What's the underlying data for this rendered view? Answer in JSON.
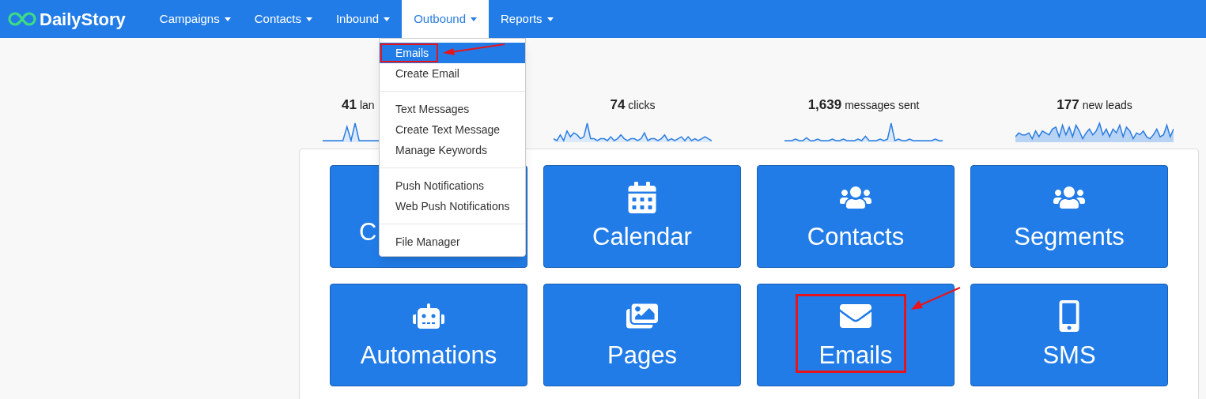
{
  "brand": {
    "name": "DailyStory"
  },
  "nav": [
    {
      "label": "Campaigns",
      "selected": false
    },
    {
      "label": "Contacts",
      "selected": false
    },
    {
      "label": "Inbound",
      "selected": false
    },
    {
      "label": "Outbound",
      "selected": true
    },
    {
      "label": "Reports",
      "selected": false
    }
  ],
  "dropdown": {
    "groups": [
      [
        {
          "label": "Emails",
          "selected": true,
          "callout": true
        },
        {
          "label": "Create Email",
          "selected": false,
          "callout": false
        }
      ],
      [
        {
          "label": "Text Messages",
          "selected": false,
          "callout": false
        },
        {
          "label": "Create Text Message",
          "selected": false,
          "callout": false
        },
        {
          "label": "Manage Keywords",
          "selected": false,
          "callout": false
        }
      ],
      [
        {
          "label": "Push Notifications",
          "selected": false,
          "callout": false
        },
        {
          "label": "Web Push Notifications",
          "selected": false,
          "callout": false
        }
      ],
      [
        {
          "label": "File Manager",
          "selected": false,
          "callout": false
        }
      ]
    ]
  },
  "stats": [
    {
      "value": "41",
      "label": "lan"
    },
    {
      "value": "74",
      "label": "clicks"
    },
    {
      "value": "1,639",
      "label": "messages sent"
    },
    {
      "value": "177",
      "label": "new leads"
    }
  ],
  "tiles": [
    {
      "label": "C",
      "callout": false
    },
    {
      "label": "Calendar",
      "callout": false
    },
    {
      "label": "Contacts",
      "callout": false
    },
    {
      "label": "Segments",
      "callout": false
    },
    {
      "label": "Automations",
      "callout": false
    },
    {
      "label": "Pages",
      "callout": false
    },
    {
      "label": "Emails",
      "callout": true
    },
    {
      "label": "SMS",
      "callout": false
    }
  ]
}
